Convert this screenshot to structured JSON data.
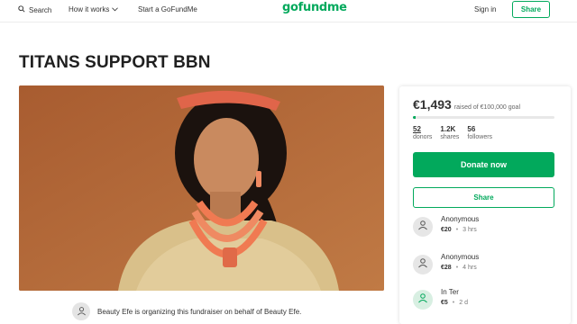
{
  "header": {
    "search_label": "Search",
    "how_label": "How it works",
    "start_label": "Start a GoFundMe",
    "logo_text": "gofundme",
    "signin_label": "Sign in",
    "share_label": "Share",
    "brand_color": "#02a95c"
  },
  "campaign": {
    "title": "TITANS SUPPORT BBN",
    "organizer_text": "Beauty Efe is organizing this fundraiser on behalf of Beauty Efe."
  },
  "sidebar": {
    "raised_amount": "€1,493",
    "raised_goal": "raised of €100,000 goal",
    "progress_fraction": 0.01493,
    "stats": [
      {
        "num": "52",
        "label": "donors"
      },
      {
        "num": "1.2K",
        "label": "shares"
      },
      {
        "num": "56",
        "label": "followers"
      }
    ],
    "donate_label": "Donate now",
    "share_label": "Share",
    "donations": [
      {
        "name": "Anonymous",
        "amount": "€20",
        "time": "3 hrs"
      },
      {
        "name": "Anonymous",
        "amount": "€28",
        "time": "4 hrs"
      },
      {
        "name": "In Ter",
        "amount": "€5",
        "time": "2 d"
      }
    ]
  }
}
